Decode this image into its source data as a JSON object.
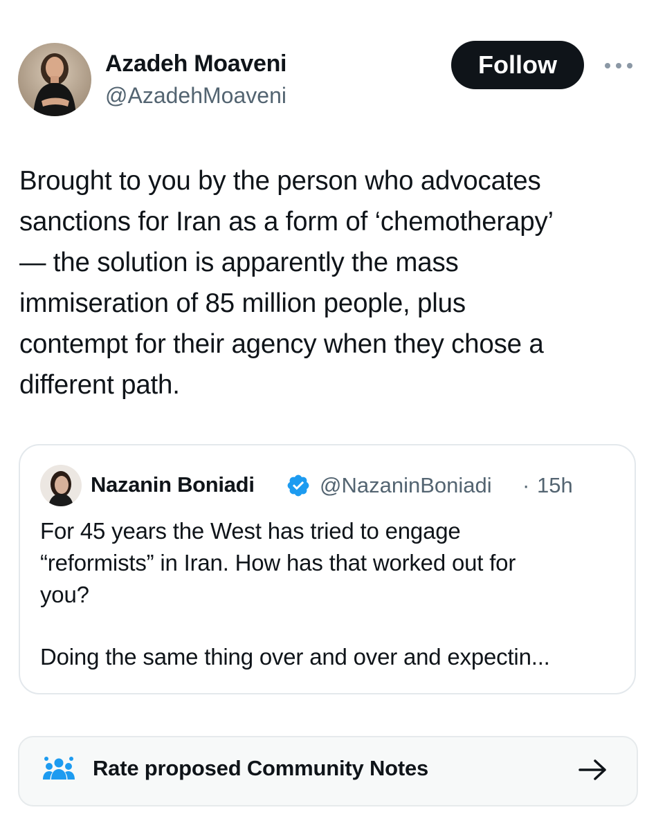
{
  "author": {
    "name": "Azadeh Moaveni",
    "handle": "@AzadehMoaveni",
    "avatar_icon": "avatar-photo-icon"
  },
  "follow_button": {
    "label": "Follow",
    "background": "#0f1419",
    "color": "#ffffff"
  },
  "more_icon": "more-horizontal-icon",
  "tweet": {
    "text": "Brought to you by the person who advocates\nsanctions for Iran as a form of ‘chemotherapy’\n— the solution is apparently the mass\nimmiseration of 85 million people, plus\ncontempt for their agency when they chose a\ndifferent path."
  },
  "quote": {
    "name": "Nazanin Boniadi",
    "verified_icon": "verified-badge-icon",
    "verified_color": "#1d9bf0",
    "handle": "@NazaninBoniadi",
    "separator": "·",
    "time": "15h",
    "text": "For 45 years the West has tried to engage\n“reformists” in Iran. How has that worked out for\nyou?",
    "text_continued": "Doing the same thing over and over and expectin..."
  },
  "community_notes": {
    "icon": "people-group-icon",
    "icon_color": "#1d9bf0",
    "label": "Rate proposed Community Notes",
    "arrow_icon": "arrow-right-icon"
  },
  "colors": {
    "text_primary": "#0f1419",
    "text_secondary": "#536471",
    "border": "#e3e8ec",
    "notes_background": "#f7f9f9"
  }
}
